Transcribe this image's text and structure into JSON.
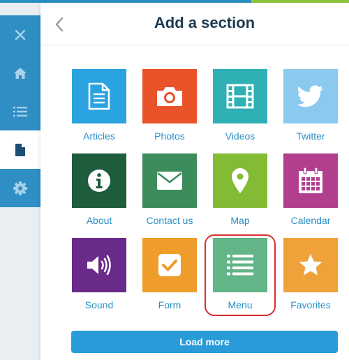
{
  "header": {
    "title": "Add a section"
  },
  "rail": [
    {
      "name": "close-icon",
      "active": false
    },
    {
      "name": "home-icon",
      "active": false
    },
    {
      "name": "list-icon",
      "active": false
    },
    {
      "name": "page-icon",
      "active": true
    },
    {
      "name": "gear-icon",
      "active": false
    }
  ],
  "sections": [
    {
      "label": "Articles",
      "icon": "article-icon",
      "color": "#2aa3e0"
    },
    {
      "label": "Photos",
      "icon": "camera-icon",
      "color": "#e8532a"
    },
    {
      "label": "Videos",
      "icon": "film-icon",
      "color": "#2eb0b4"
    },
    {
      "label": "Twitter",
      "icon": "twitter-bird-icon",
      "color": "#8cc9ef"
    },
    {
      "label": "About",
      "icon": "info-icon",
      "color": "#1f5c3c"
    },
    {
      "label": "Contact us",
      "icon": "envelope-icon",
      "color": "#3d8c5c"
    },
    {
      "label": "Map",
      "icon": "map-pin-icon",
      "color": "#83bb35"
    },
    {
      "label": "Calendar",
      "icon": "calendar-icon",
      "color": "#b13f8e"
    },
    {
      "label": "Sound",
      "icon": "speaker-icon",
      "color": "#6a2a8a"
    },
    {
      "label": "Form",
      "icon": "checkbox-icon",
      "color": "#ef9d2a"
    },
    {
      "label": "Menu",
      "icon": "menu-list-icon",
      "color": "#62b587"
    },
    {
      "label": "Favorites",
      "icon": "star-icon",
      "color": "#efa23a"
    }
  ],
  "highlighted_section": "Menu",
  "load_more_label": "Load more"
}
